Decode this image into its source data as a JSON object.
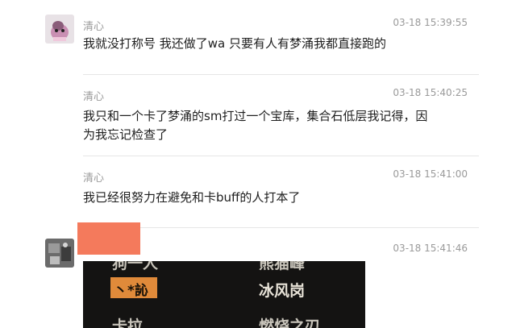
{
  "messages": [
    {
      "name": "清心",
      "time": "03-18 15:39:55",
      "lines": [
        "我就没打称号 我还做了wa 只要有人有梦涌我都直接跑的"
      ]
    },
    {
      "name": "清心",
      "time": "03-18 15:40:25",
      "lines": [
        "我只和一个卡了梦涌的sm打过一个宝库，集合石低层我记得，因",
        "为我忘记检查了"
      ]
    },
    {
      "name": "清心",
      "time": "03-18 15:41:00",
      "lines": [
        "我已经很努力在避免和卡buff的人打本了"
      ]
    },
    {
      "time": "03-18 15:41:46"
    }
  ],
  "game_screenshot": {
    "row1_left": "狗一人",
    "row1_right": "熊猫峰",
    "row2_left": "丶*訫",
    "row2_right": "冰风岗",
    "row3_left": "卡拉",
    "row3_right": "燃烧之刃"
  },
  "colors": {
    "redaction": "#f47a5c",
    "highlight": "#e08a3a",
    "game_bg": "#141312"
  }
}
